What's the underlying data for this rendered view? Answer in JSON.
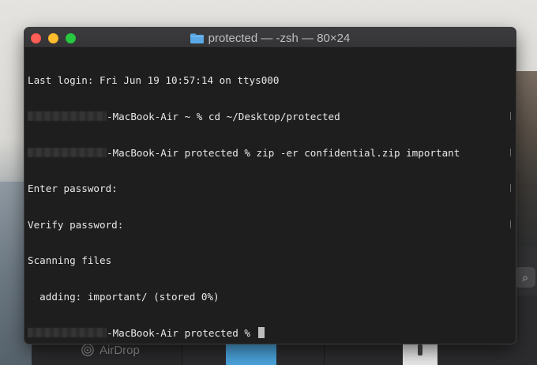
{
  "window": {
    "title": "protected — -zsh — 80×24",
    "folder_icon": "folder-icon"
  },
  "terminal": {
    "lines": {
      "l0": "Last login: Fri Jun 19 10:57:14 on ttys000",
      "l1": "-MacBook-Air ~ % cd ~/Desktop/protected",
      "l2": "-MacBook-Air protected % zip -er confidential.zip important",
      "l3": "Enter password:",
      "l4": "Verify password:",
      "l5": "Scanning files",
      "l6": "  adding: important/ (stored 0%)",
      "l7": "-MacBook-Air protected % "
    }
  },
  "finder": {
    "airdrop_label": "AirDrop"
  },
  "colors": {
    "terminal_bg": "#1e1e1e",
    "text": "#e8e8e8",
    "close": "#fe5f57",
    "minimize": "#febc2e",
    "maximize": "#28c840",
    "folder": "#5aa9e6"
  }
}
